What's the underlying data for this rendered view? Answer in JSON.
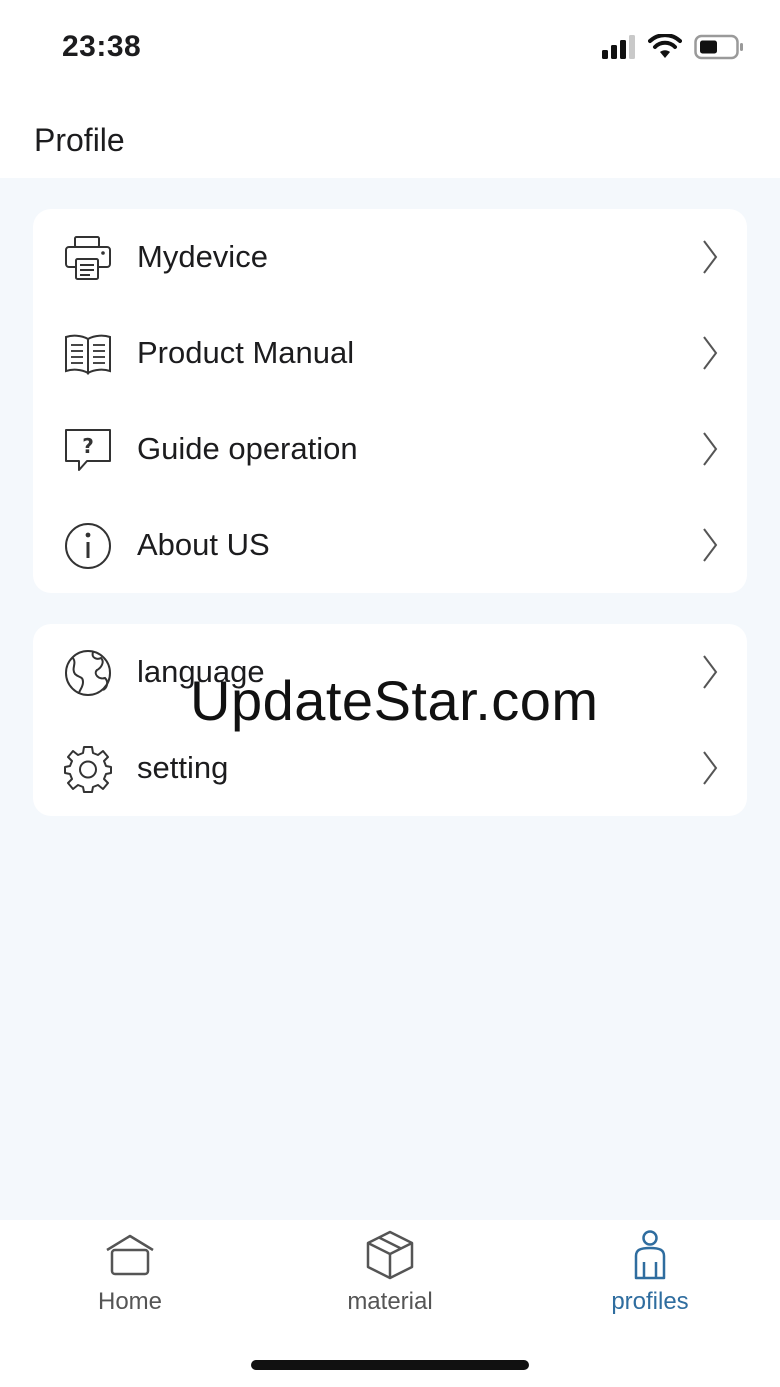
{
  "status_bar": {
    "time": "23:38",
    "icons": [
      "signal-icon",
      "wifi-icon",
      "battery-icon"
    ]
  },
  "header": {
    "title": "Profile"
  },
  "menu_group_1": [
    {
      "label": "Mydevice",
      "icon": "printer-icon"
    },
    {
      "label": "Product Manual",
      "icon": "book-icon"
    },
    {
      "label": "Guide operation",
      "icon": "help-bubble-icon"
    },
    {
      "label": "About US",
      "icon": "info-icon"
    }
  ],
  "menu_group_2": [
    {
      "label": "language",
      "icon": "globe-icon"
    },
    {
      "label": "setting",
      "icon": "gear-icon"
    }
  ],
  "watermark": "UpdateStar.com",
  "tabbar": {
    "tabs": [
      {
        "label": "Home",
        "icon": "home-icon",
        "active": false
      },
      {
        "label": "material",
        "icon": "box-icon",
        "active": false
      },
      {
        "label": "profiles",
        "icon": "person-icon",
        "active": true
      }
    ]
  },
  "colors": {
    "background": "#f4f8fc",
    "card": "#ffffff",
    "active_tab": "#2f6d9f",
    "text": "#1c1c1e"
  }
}
